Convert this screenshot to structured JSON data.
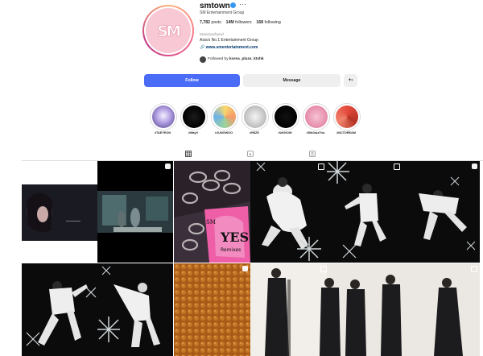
{
  "profile": {
    "username": "smtown",
    "display_name": "SM Entertainment Group",
    "posts": "7,782",
    "posts_label": "posts",
    "followers": "14M",
    "followers_label": "followers",
    "following": "168",
    "following_label": "following",
    "category": "Musician/band",
    "bio": "Asia's No.1 Entertainment Group",
    "link": "www.smentertainment.com",
    "followed_by_prefix": "Followed by",
    "followed_by_user": "korea_plaza_ktxhk"
  },
  "actions": {
    "follow": "Follow",
    "message": "Message",
    "suggest_icon": "add-person-icon"
  },
  "highlights": [
    {
      "label": "#TAEYEON"
    },
    {
      "label": "#WayV"
    },
    {
      "label": "#JUNGWOO"
    },
    {
      "label": "#RIIZE"
    },
    {
      "label": "#UKNOW"
    },
    {
      "label": "#SMJazzTrio"
    },
    {
      "label": "#NCTDREAM"
    }
  ],
  "tabs": [
    {
      "name": "posts",
      "icon": "grid-icon"
    },
    {
      "name": "reels",
      "icon": "reels-icon"
    },
    {
      "name": "tagged",
      "icon": "tagged-icon"
    }
  ],
  "posts_grid": {
    "yes_title": "YES",
    "yes_subtitle": "Remixes"
  },
  "colors": {
    "follow_blue": "#4a6cf7",
    "link_blue": "#00376b",
    "avatar_pink": "#f8c9d4"
  }
}
